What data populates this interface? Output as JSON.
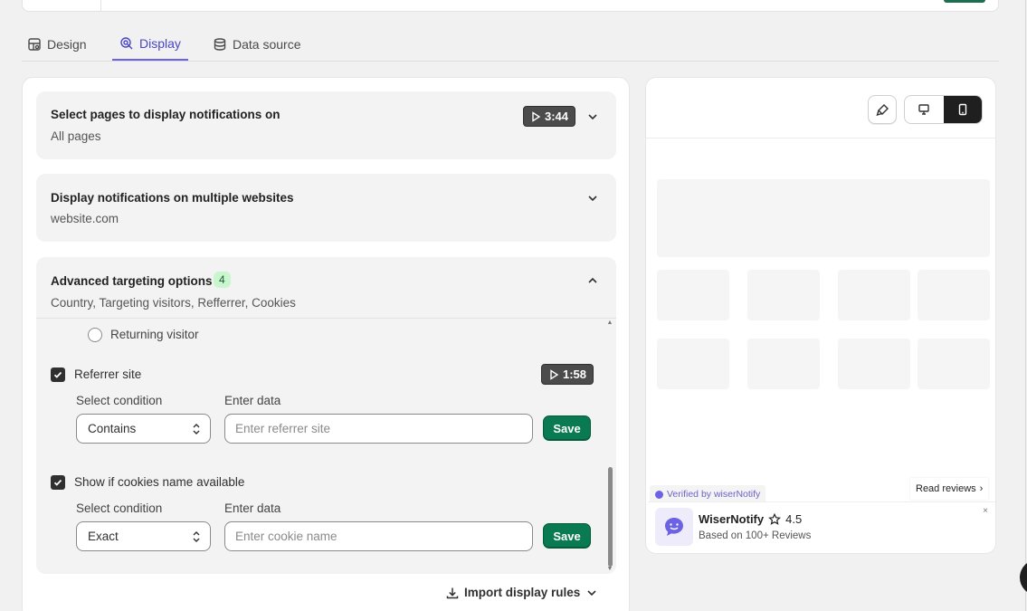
{
  "tabs": [
    {
      "label": "Design",
      "icon": "design-icon"
    },
    {
      "label": "Display",
      "icon": "display-icon"
    },
    {
      "label": "Data source",
      "icon": "database-icon"
    }
  ],
  "sections": {
    "pages": {
      "title": "Select pages to display notifications on",
      "subtitle": "All pages",
      "video": "3:44"
    },
    "websites": {
      "title": "Display notifications on multiple websites",
      "subtitle": "website.com"
    },
    "advanced": {
      "title": "Advanced targeting options",
      "count": "4",
      "subtitle": "Country, Targeting visitors, Refferrer, Cookies"
    }
  },
  "advanced_options": {
    "returning_visitor_label": "Returning visitor",
    "referrer": {
      "label": "Referrer site",
      "video": "1:58",
      "condition_label": "Select condition",
      "data_label": "Enter data",
      "condition_value": "Contains",
      "input_placeholder": "Enter referrer site",
      "save_label": "Save"
    },
    "cookies": {
      "label": "Show if cookies name available",
      "condition_label": "Select condition",
      "data_label": "Enter data",
      "condition_value": "Exact",
      "input_placeholder": "Enter cookie name",
      "save_label": "Save"
    }
  },
  "import_label": "Import display rules",
  "preview": {
    "verified_text": "Verified by wiserNotify",
    "read_reviews": "Read reviews",
    "brand": "WiserNotify",
    "rating": "4.5",
    "review_sub": "Based on 100+ Reviews",
    "close": "×"
  },
  "colors": {
    "accent": "#6b63e3",
    "save_green": "#0a7a52",
    "badge_green": "#c9f5cf"
  }
}
